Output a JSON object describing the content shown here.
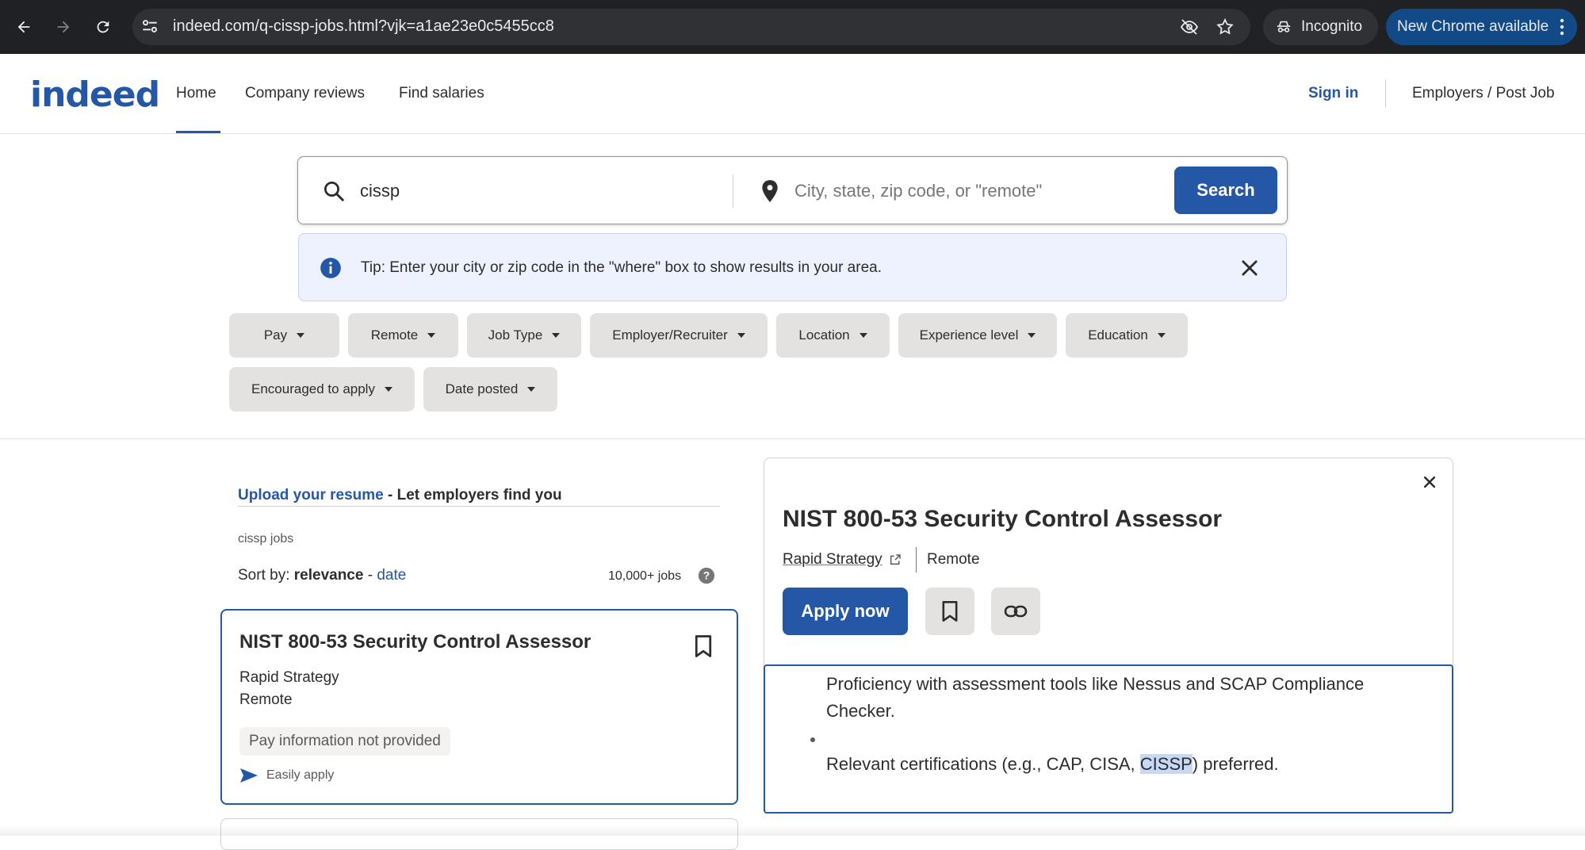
{
  "browser": {
    "url": "indeed.com/q-cissp-jobs.html?vjk=a1ae23e0c5455cc8",
    "incognito_label": "Incognito",
    "update_label": "New Chrome available"
  },
  "header": {
    "logo": "indeed",
    "nav": [
      "Home",
      "Company reviews",
      "Find salaries"
    ],
    "sign_in": "Sign in",
    "employers": "Employers / Post Job"
  },
  "search": {
    "what_value": "cissp",
    "where_placeholder": "City, state, zip code, or \"remote\"",
    "button": "Search"
  },
  "tip": {
    "text": "Tip: Enter your city or zip code in the \"where\" box to show results in your area."
  },
  "filters": [
    "Pay",
    "Remote",
    "Job Type",
    "Employer/Recruiter",
    "Location",
    "Experience level",
    "Education",
    "Encouraged to apply",
    "Date posted"
  ],
  "results": {
    "upload_link": "Upload your resume",
    "upload_rest": " - Let employers find you",
    "breadcrumb": "cissp jobs",
    "sort_label": "Sort by:",
    "sort_relevance": "relevance",
    "sort_sep": " - ",
    "sort_date": "date",
    "count": "10,000+ jobs"
  },
  "job_card": {
    "title": "NIST 800-53 Security Control Assessor",
    "company": "Rapid Strategy",
    "location": "Remote",
    "pay": "Pay information not provided",
    "easy_apply": "Easily apply"
  },
  "detail": {
    "title": "NIST 800-53 Security Control Assessor",
    "company": "Rapid Strategy",
    "location": "Remote",
    "apply": "Apply now",
    "desc_line1": "Proficiency with assessment tools like Nessus and SCAP Compliance",
    "desc_line2": "Checker.",
    "desc_line3_pre": "Relevant certifications (e.g., CAP, CISA, ",
    "desc_line3_hl": "CISSP",
    "desc_line3_post": ") preferred."
  },
  "colors": {
    "brand": "#2557a7",
    "chrome_bg": "#202124",
    "tip_bg": "#eef1fe",
    "filter_bg": "#e4e2e0"
  }
}
